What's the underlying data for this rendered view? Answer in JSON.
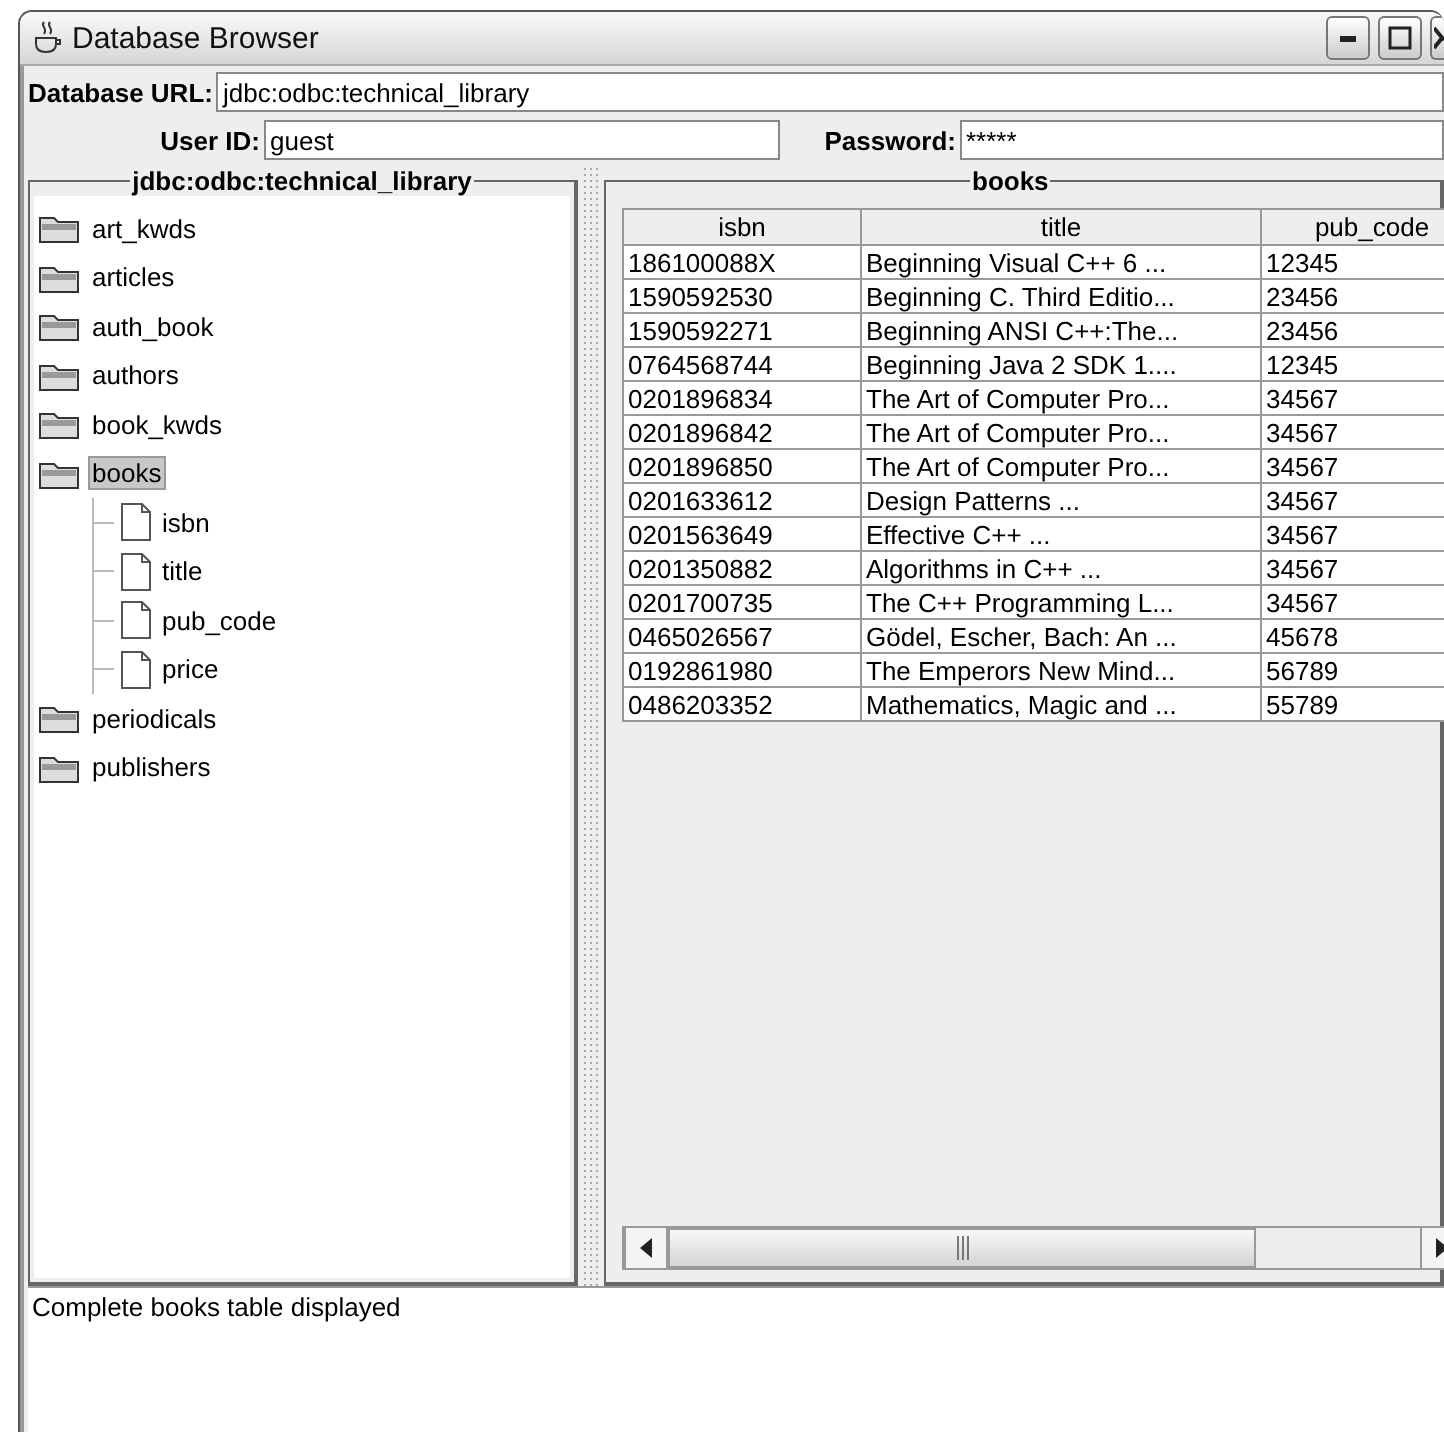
{
  "window": {
    "title": "Database Browser"
  },
  "connection": {
    "url_label": "Database URL:",
    "url": "jdbc:odbc:technical_library",
    "user_label": "User ID:",
    "user": "guest",
    "password_label": "Password:",
    "password": "*****"
  },
  "tree": {
    "title": "jdbc:odbc:technical_library",
    "items": [
      {
        "label": "art_kwds",
        "selected": false
      },
      {
        "label": "articles",
        "selected": false
      },
      {
        "label": "auth_book",
        "selected": false
      },
      {
        "label": "authors",
        "selected": false
      },
      {
        "label": "book_kwds",
        "selected": false
      },
      {
        "label": "books",
        "selected": true,
        "children": [
          {
            "label": "isbn",
            "selected": false
          },
          {
            "label": "title",
            "selected": false
          },
          {
            "label": "pub_code",
            "selected": false
          },
          {
            "label": "price",
            "selected": false
          }
        ]
      },
      {
        "label": "periodicals",
        "selected": false
      },
      {
        "label": "publishers",
        "selected": false
      }
    ]
  },
  "table": {
    "title": "books",
    "columns": [
      "isbn",
      "title",
      "pub_code"
    ],
    "rows": [
      [
        "186100088X",
        "Beginning Visual C++ 6  ...",
        "12345"
      ],
      [
        "1590592530",
        "Beginning C. Third Editio...",
        "23456"
      ],
      [
        "1590592271",
        "Beginning ANSI C++:The...",
        "23456"
      ],
      [
        "0764568744",
        "Beginning Java 2 SDK 1....",
        "12345"
      ],
      [
        "0201896834",
        "The Art of Computer Pro...",
        "34567"
      ],
      [
        "0201896842",
        "The Art of Computer Pro...",
        "34567"
      ],
      [
        "0201896850",
        "The Art of Computer Pro...",
        "34567"
      ],
      [
        "0201633612",
        "Design Patterns ...",
        "34567"
      ],
      [
        "0201563649",
        "Effective C++ ...",
        "34567"
      ],
      [
        "0201350882",
        "Algorithms in C++ ...",
        "34567"
      ],
      [
        "0201700735",
        "The C++ Programming L...",
        "34567"
      ],
      [
        "0465026567",
        "Gödel, Escher, Bach: An ...",
        "45678"
      ],
      [
        "0192861980",
        "The Emperors New Mind...",
        "56789"
      ],
      [
        "0486203352",
        "Mathematics, Magic and ...",
        "55789"
      ]
    ]
  },
  "status_text": "Complete books table displayed"
}
